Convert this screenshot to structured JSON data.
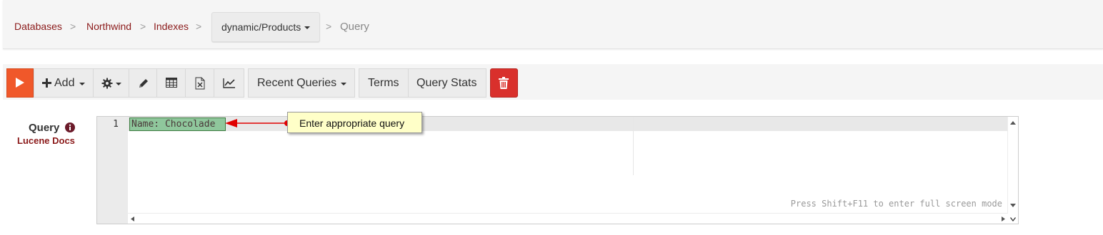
{
  "breadcrumb": {
    "items": [
      "Databases",
      "Northwind",
      "Indexes"
    ],
    "separator": ">",
    "dropdown_label": "dynamic/Products",
    "current": "Query"
  },
  "toolbar": {
    "run_icon": "play-icon",
    "add_label": "Add",
    "recent_queries_label": "Recent Queries",
    "terms_label": "Terms",
    "query_stats_label": "Query Stats",
    "icons": [
      "plus-icon",
      "gear-icon",
      "pencil-icon",
      "table-icon",
      "excel-icon",
      "line-chart-icon",
      "trash-icon"
    ]
  },
  "query": {
    "label": "Query",
    "docs_link": "Lucene Docs",
    "line_number": "1",
    "code": "Name: Chocolade",
    "fullscreen_hint": "Press Shift+F11 to enter full screen mode"
  },
  "callout": {
    "text": "Enter appropriate query"
  },
  "colors": {
    "accent": "#f0582a",
    "danger": "#d9302c",
    "link": "#8b1a1a",
    "selection": "#8fc79c",
    "callout_bg": "#ffffc8",
    "callout_arrow": "#e00000"
  }
}
